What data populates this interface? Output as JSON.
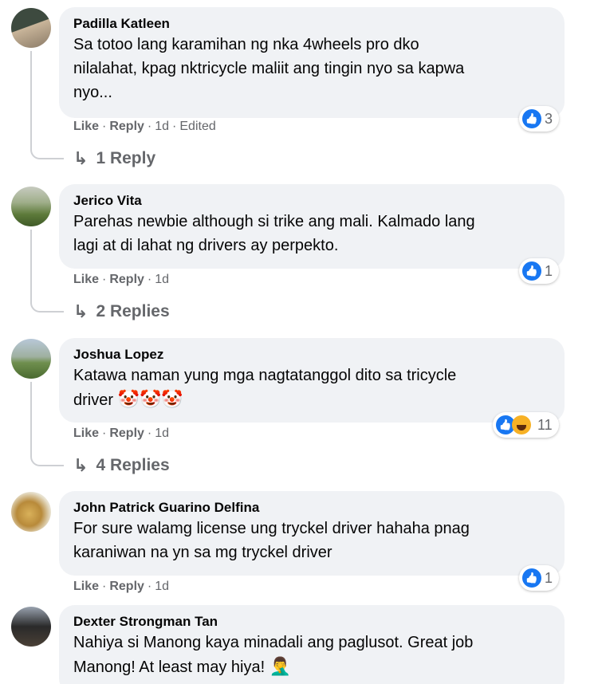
{
  "comments": [
    {
      "author": "Padilla Katleen",
      "text": "Sa totoo lang karamihan ng nka 4wheels pro dko nilalahat, kpag nktricycle maliit ang tingin nyo sa kapwa nyo...",
      "line1": "Sa totoo lang karamihan ng nka 4wheels pro dko",
      "line2": "nilalahat, kpag nktricycle maliit ang tingin nyo sa kapwa",
      "line3": "nyo...",
      "like": "Like",
      "reply": "Reply",
      "time": "1d",
      "edited": "Edited",
      "reaction_count": "3",
      "replies_label": "1 Reply",
      "avatar_colors": [
        "#3d4a3f",
        "#c9b59a"
      ]
    },
    {
      "author": "Jerico Vita",
      "line1": "Parehas newbie although si trike ang mali. Kalmado lang",
      "line2": "lagi at di lahat ng drivers ay perpekto.",
      "like": "Like",
      "reply": "Reply",
      "time": "1d",
      "reaction_count": "1",
      "replies_label": "2 Replies",
      "avatar_colors": [
        "#5d7a3a",
        "#c7cbc0"
      ]
    },
    {
      "author": "Joshua Lopez",
      "line1": "Katawa naman yung mga nagtatanggol dito sa tricycle",
      "line2": "driver",
      "emojis": "🤡🤡🤡",
      "like": "Like",
      "reply": "Reply",
      "time": "1d",
      "reaction_count": "11",
      "replies_label": "4 Replies",
      "avatar_colors": [
        "#6f8f4e",
        "#b8c8d8"
      ]
    },
    {
      "author": "John Patrick Guarino Delfina",
      "line1": "For sure walamg license ung tryckel driver hahaha pnag",
      "line2": "karaniwan na yn sa mg tryckel driver",
      "like": "Like",
      "reply": "Reply",
      "time": "1d",
      "reaction_count": "1",
      "avatar_colors": [
        "#d9b15a",
        "#e8e2d0"
      ]
    },
    {
      "author": "Dexter Strongman Tan",
      "line1": "Nahiya si Manong kaya minadali ang paglusot. Great job",
      "line2": "Manong! At least may hiya!",
      "emojis": "🤦‍♂️",
      "avatar_colors": [
        "#2a2a2a",
        "#9aa3b0"
      ]
    }
  ],
  "separator": "·"
}
